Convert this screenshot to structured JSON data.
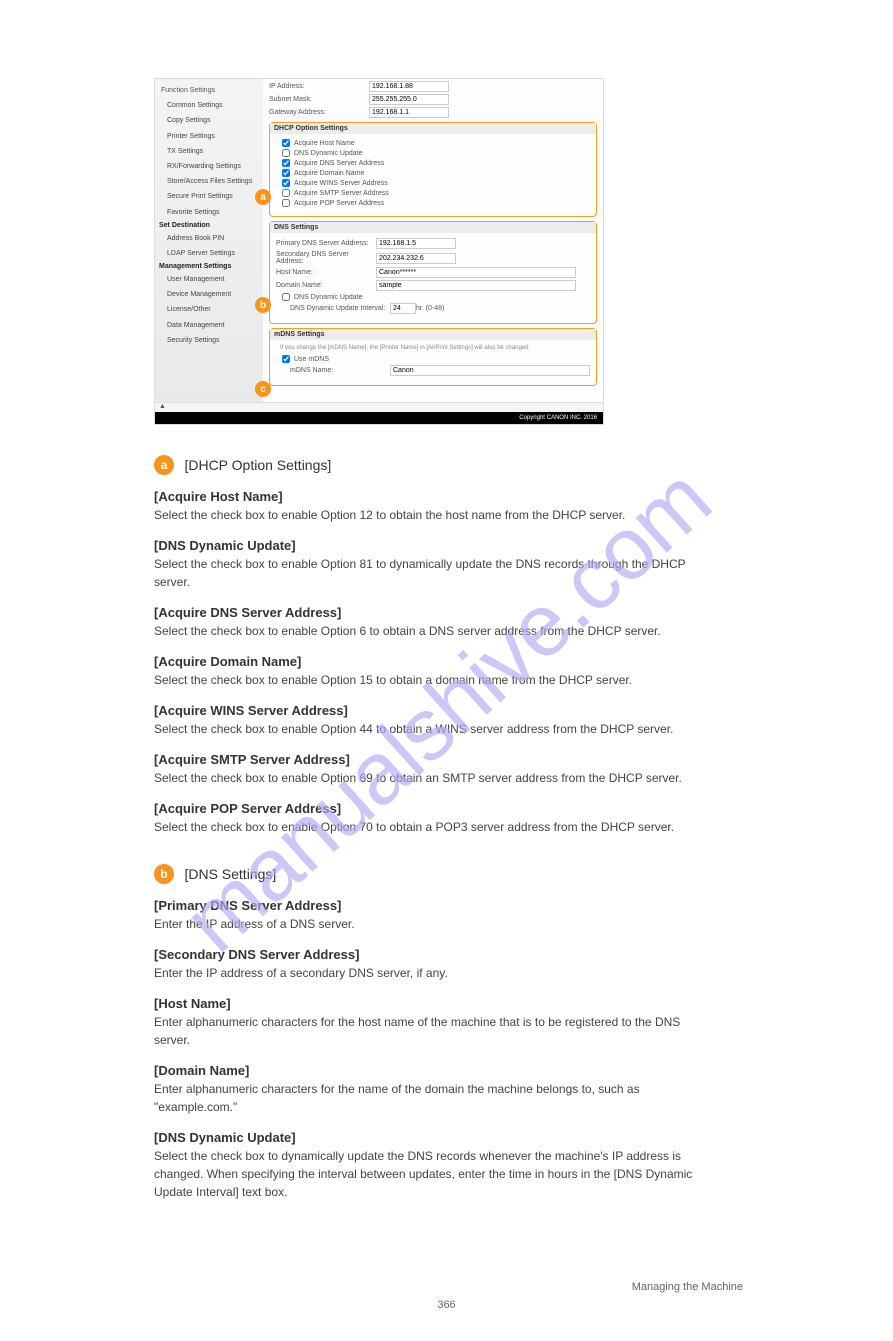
{
  "watermark": "manualshive.com",
  "screenshot": {
    "sidebar": {
      "items": [
        "Function Settings",
        "Common Settings",
        "Copy Settings",
        "Printer Settings",
        "TX Settings",
        "RX/Forwarding Settings",
        "Store/Access Files Settings",
        "Secure Print Settings",
        "Favorite Settings"
      ],
      "setdest_head": "Set Destination",
      "setdest_items": [
        "Address Book PIN",
        "LDAP Server Settings"
      ],
      "mgmt_head": "Management Settings",
      "mgmt_items": [
        "User Management",
        "Device Management",
        "License/Other",
        "Data Management",
        "Security Settings"
      ]
    },
    "top": {
      "ip_label": "IP Address:",
      "ip_val": "192.168.1.88",
      "subnet_label": "Subnet Mask:",
      "subnet_val": "255.255.255.0",
      "gw_label": "Gateway Address:",
      "gw_val": "192.168.1.1"
    },
    "dhcp": {
      "title": "DHCP Option Settings",
      "items": [
        "Acquire Host Name",
        "DNS Dynamic Update",
        "Acquire DNS Server Address",
        "Acquire Domain Name",
        "Acquire WINS Server Address",
        "Acquire SMTP Server Address",
        "Acquire POP Server Address"
      ]
    },
    "dns": {
      "title": "DNS Settings",
      "primary_label": "Primary DNS Server Address:",
      "primary_val": "192.168.1.5",
      "secondary_label": "Secondary DNS Server Address:",
      "secondary_val": "202.234.232.6",
      "host_label": "Host Name:",
      "host_val": "Canon******",
      "domain_label": "Domain Name:",
      "domain_val": "sample",
      "dyn_label": "DNS Dynamic Update",
      "interval_label": "DNS Dynamic Update Interval:",
      "interval_val": "24",
      "interval_unit": "hr. (0-48)"
    },
    "mdns": {
      "title": "mDNS Settings",
      "note": "If you change the [mDNS Name], the [Printer Name] in [AirPrint Settings] will also be changed.",
      "use_label": "Use mDNS",
      "name_label": "mDNS Name:",
      "name_val": "Canon"
    },
    "footer": "Copyright CANON INC. 2016"
  },
  "expl": {
    "a": {
      "title": "[DHCP Option Settings]",
      "opts": {
        "host": {
          "label": "[Acquire Host Name]",
          "desc": "Select the check box to enable Option 12 to obtain the host name from the DHCP server."
        },
        "dyn": {
          "label": "[DNS Dynamic Update]",
          "desc": "Select the check box to enable Option 81 to dynamically update the DNS records through the DHCP server."
        },
        "dnsaddr": {
          "label": "[Acquire DNS Server Address]",
          "desc": "Select the check box to enable Option 6 to obtain a DNS server address from the DHCP server."
        },
        "domain": {
          "label": "[Acquire Domain Name]",
          "desc": "Select the check box to enable Option 15 to obtain a domain name from the DHCP server."
        },
        "wins": {
          "label": "[Acquire WINS Server Address]",
          "desc": "Select the check box to enable Option 44 to obtain a WINS server address from the DHCP server."
        },
        "smtp": {
          "label": "[Acquire SMTP Server Address]",
          "desc": "Select the check box to enable Option 69 to obtain an SMTP server address from the DHCP server."
        },
        "pop": {
          "label": "[Acquire POP Server Address]",
          "desc": "Select the check box to enable Option 70 to obtain a POP3 server address from the DHCP server."
        }
      }
    },
    "b": {
      "title": "[DNS Settings]",
      "primary": {
        "label": "[Primary DNS Server Address]",
        "desc": "Enter the IP address of a DNS server."
      },
      "secondary": {
        "label": "[Secondary DNS Server Address]",
        "desc": "Enter the IP address of a secondary DNS server, if any."
      },
      "host": {
        "label": "[Host Name]",
        "desc": "Enter alphanumeric characters for the host name of the machine that is to be registered to the DNS server."
      },
      "domain": {
        "label": "[Domain Name]",
        "desc": "Enter alphanumeric characters for the name of the domain the machine belongs to, such as \"example.com.\""
      },
      "dyn": {
        "label": "[DNS Dynamic Update]",
        "desc": "Select the check box to dynamically update the DNS records whenever the machine's IP address is changed. When specifying the interval between updates, enter the time in hours in the [DNS Dynamic Update Interval] text box."
      }
    }
  },
  "markers": {
    "a": "a",
    "b": "b",
    "c": "c"
  },
  "managing": "Managing the Machine",
  "pagenum": "366"
}
